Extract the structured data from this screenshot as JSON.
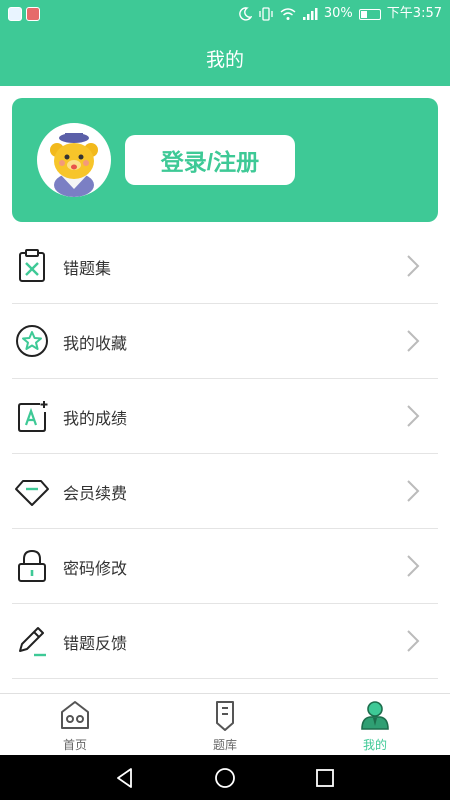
{
  "status_bar": {
    "battery": "30%",
    "time": "下午3:57",
    "icons": [
      "app-icon",
      "app-icon",
      "moon-icon",
      "vibrate-icon",
      "wifi-icon",
      "signal-icon",
      "battery-icon"
    ]
  },
  "header": {
    "title": "我的"
  },
  "profile": {
    "login_label": "登录/注册",
    "avatar_icon": "bear-mascot-avatar"
  },
  "menu": {
    "items": [
      {
        "label": "错题集",
        "icon": "clipboard-x-icon"
      },
      {
        "label": "我的收藏",
        "icon": "star-circle-icon"
      },
      {
        "label": "我的成绩",
        "icon": "grade-a-plus-icon"
      },
      {
        "label": "会员续费",
        "icon": "diamond-icon"
      },
      {
        "label": "密码修改",
        "icon": "lock-icon"
      },
      {
        "label": "错题反馈",
        "icon": "pencil-icon"
      }
    ]
  },
  "tabs": [
    {
      "label": "首页",
      "icon": "home-icon"
    },
    {
      "label": "题库",
      "icon": "question-bank-icon"
    },
    {
      "label": "我的",
      "icon": "profile-icon",
      "active": true
    }
  ],
  "colors": {
    "accent": "#3ec996",
    "text": "#333333",
    "divider": "#e4e4e4"
  }
}
